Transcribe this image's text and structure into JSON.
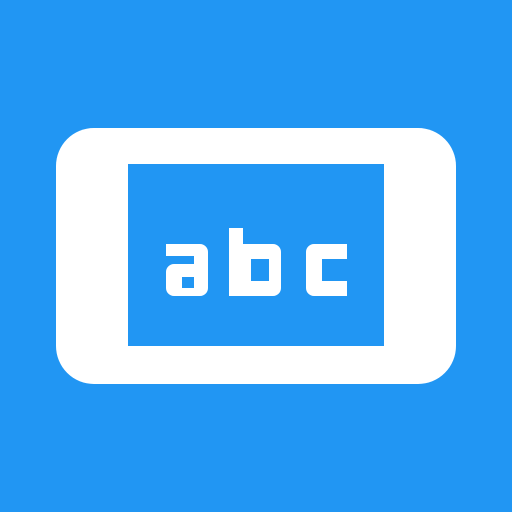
{
  "icon": {
    "name": "device-text-icon",
    "screen_text": "abc",
    "colors": {
      "background": "#2196F3",
      "frame": "#FFFFFF",
      "screen": "#2196F3",
      "text": "#FFFFFF"
    }
  }
}
